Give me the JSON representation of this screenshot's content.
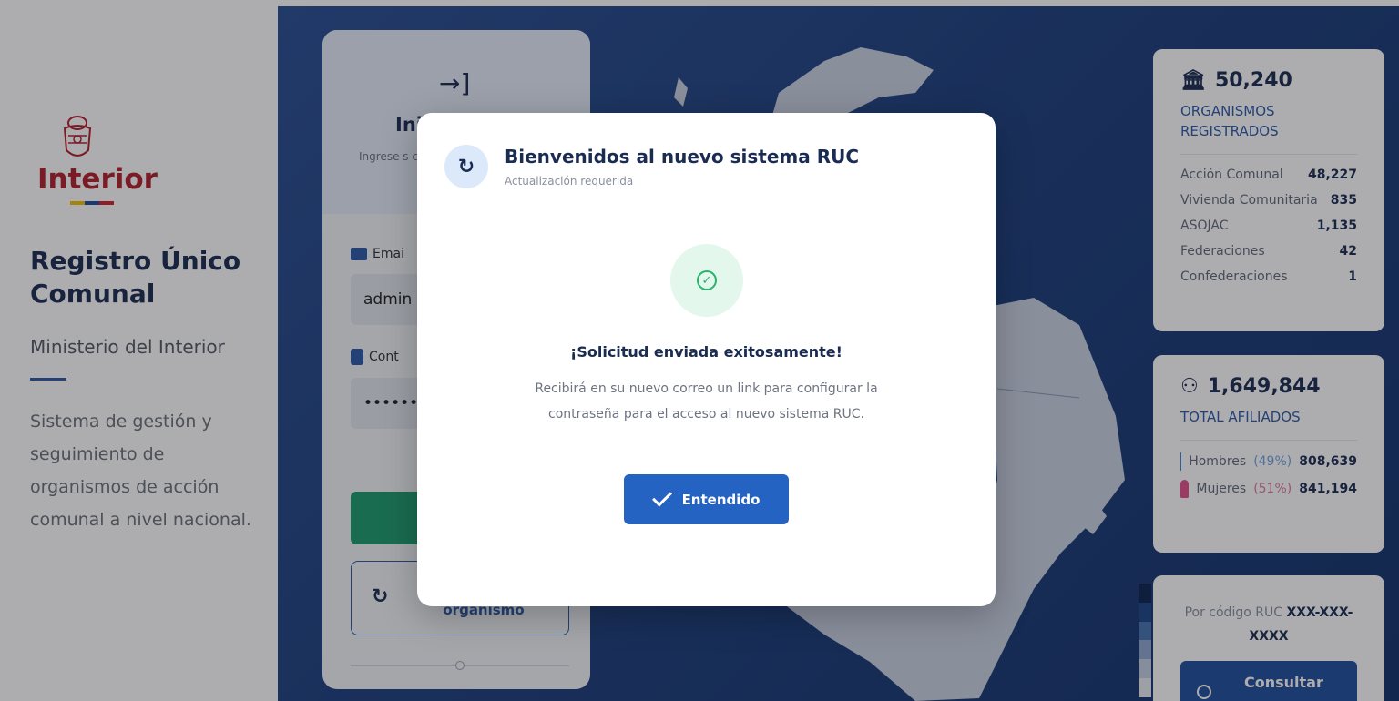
{
  "brand": {
    "name": "Interior",
    "app_title": "Registro Único Comunal",
    "ministry": "Ministerio del Interior",
    "description": "Sistema de gestión y seguimiento de organismos de acción comunal a nivel nacional.",
    "flag_colors": [
      "#f2c200",
      "#1f4fa3",
      "#d1262f"
    ]
  },
  "login": {
    "icon": "login-arrow-icon",
    "title": "Ini",
    "subtitle": "Ingrese s continua",
    "email_label": "Emai",
    "email_value": "admin",
    "password_label": "Cont",
    "password_value": "••••••",
    "update_button_label": "organismo"
  },
  "stats": {
    "organizations": {
      "total": "50,240",
      "label": "ORGANISMOS REGISTRADOS",
      "rows": [
        {
          "name": "Acción Comunal",
          "value": "48,227"
        },
        {
          "name": "Vivienda Comunitaria",
          "value": "835"
        },
        {
          "name": "ASOJAC",
          "value": "1,135"
        },
        {
          "name": "Federaciones",
          "value": "42"
        },
        {
          "name": "Confederaciones",
          "value": "1"
        }
      ]
    },
    "members": {
      "total": "1,649,844",
      "label": "TOTAL AFILIADOS",
      "men_label": "Hombres",
      "men_pct": "(49%)",
      "men_value": "808,639",
      "women_label": "Mujeres",
      "women_pct": "(51%)",
      "women_value": "841,194"
    },
    "consult": {
      "prefix": "Por código RUC",
      "code": "XXX-XXX-XXXX",
      "button_label": "Consultar"
    }
  },
  "modal": {
    "title": "Bienvenidos al nuevo sistema RUC",
    "subtitle": "Actualización requerida",
    "success_title": "¡Solicitud enviada exitosamente!",
    "success_message": "Recibirá en su nuevo correo un link para configurar la contraseña para el acceso al nuevo sistema RUC.",
    "ok_button": "Entendido"
  },
  "colors": {
    "primary": "#2563c2",
    "navy": "#1b2c52",
    "success": "#28b36b",
    "brand_red": "#b21f2d",
    "enter_green": "#1e9b6d"
  }
}
